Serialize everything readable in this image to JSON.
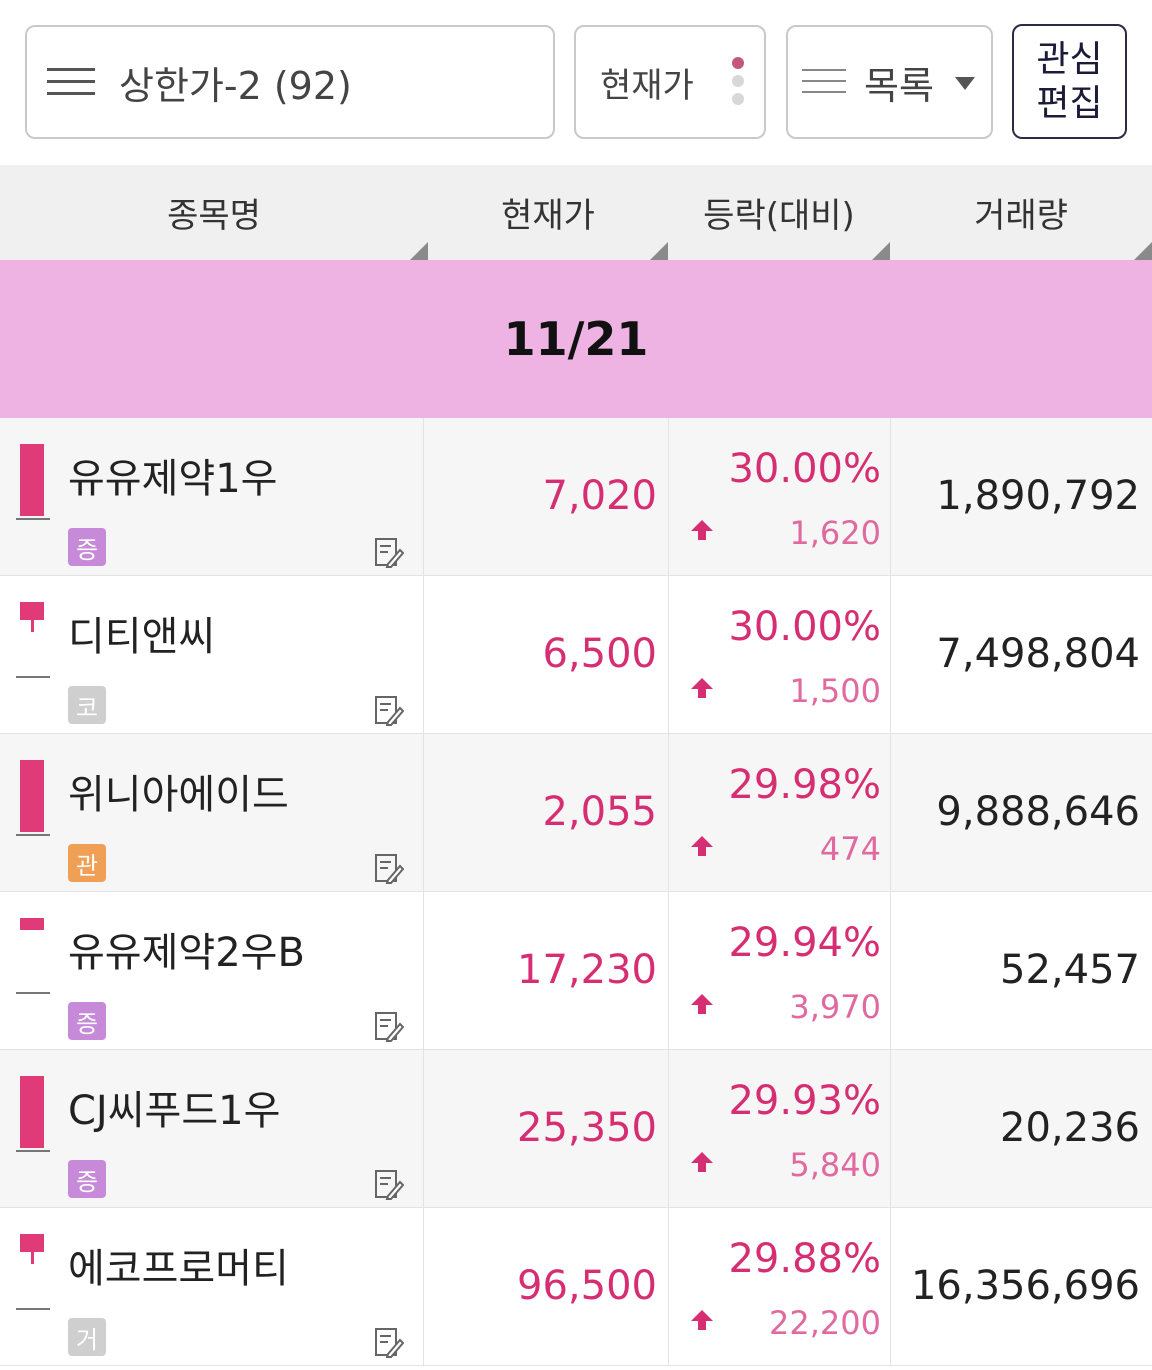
{
  "toolbar": {
    "group_label": "상한가-2 (92)",
    "price_label": "현재가",
    "view_label": "목록",
    "edit_line1": "관심",
    "edit_line2": "편집"
  },
  "header": {
    "name": "종목명",
    "price": "현재가",
    "change": "등락(대비)",
    "volume": "거래량"
  },
  "date": "11/21",
  "colors": {
    "up": "#d62e72",
    "band": "#efb3e3"
  },
  "stocks": [
    {
      "name": "유유제약1우",
      "badge": "증",
      "badge_color": "#c68ad8",
      "price": "7,020",
      "pct": "30.00%",
      "chg": "1,620",
      "volume": "1,890,792",
      "candle": "full"
    },
    {
      "name": "디티앤씨",
      "badge": "코",
      "badge_color": "#cfcfcf",
      "price": "6,500",
      "pct": "30.00%",
      "chg": "1,500",
      "volume": "7,498,804",
      "candle": "short"
    },
    {
      "name": "위니아에이드",
      "badge": "관",
      "badge_color": "#f0a055",
      "price": "2,055",
      "pct": "29.98%",
      "chg": "474",
      "volume": "9,888,646",
      "candle": "full"
    },
    {
      "name": "유유제약2우B",
      "badge": "증",
      "badge_color": "#c68ad8",
      "price": "17,230",
      "pct": "29.94%",
      "chg": "3,970",
      "volume": "52,457",
      "candle": "thin"
    },
    {
      "name": "CJ씨푸드1우",
      "badge": "증",
      "badge_color": "#c68ad8",
      "price": "25,350",
      "pct": "29.93%",
      "chg": "5,840",
      "volume": "20,236",
      "candle": "full"
    },
    {
      "name": "에코프로머티",
      "badge": "거",
      "badge_color": "#cfcfcf",
      "price": "96,500",
      "pct": "29.88%",
      "chg": "22,200",
      "volume": "16,356,696",
      "candle": "short"
    }
  ]
}
